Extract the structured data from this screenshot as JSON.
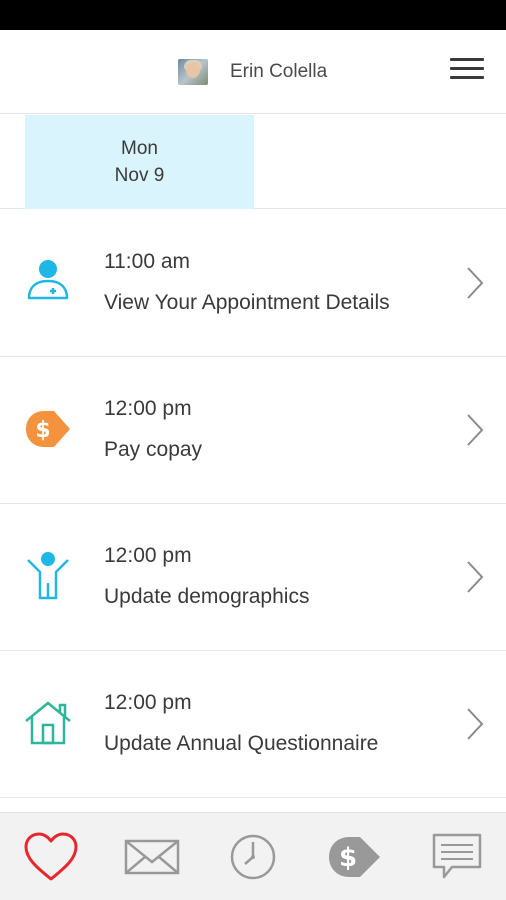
{
  "header": {
    "user_name": "Erin Colella",
    "avatar": "user-photo",
    "menu_icon": "hamburger-menu-icon"
  },
  "date_tabs": [
    {
      "day": "Mon",
      "date": "Nov 9",
      "selected": true
    }
  ],
  "appointments": [
    {
      "time": "11:00 am",
      "title": "View Your Appointment Details",
      "icon": "doctor-icon",
      "color": "#1fb8e6"
    },
    {
      "time": "12:00 pm",
      "title": "Pay copay",
      "icon": "dollar-tag-icon",
      "color": "#f5923e"
    },
    {
      "time": "12:00 pm",
      "title": "Update demographics",
      "icon": "person-arms-up-icon",
      "color": "#1fb8e6"
    },
    {
      "time": "12:00 pm",
      "title": "Update Annual Questionnaire",
      "icon": "house-icon",
      "color": "#2fb59a"
    }
  ],
  "tab_bar": [
    {
      "icon": "heart-icon",
      "color": "#e8262e",
      "active": true
    },
    {
      "icon": "envelope-icon",
      "color": "#999999",
      "active": false
    },
    {
      "icon": "clock-icon",
      "color": "#999999",
      "active": false
    },
    {
      "icon": "dollar-tag-icon",
      "color": "#999999",
      "active": false
    },
    {
      "icon": "chat-bubble-icon",
      "color": "#999999",
      "active": false
    }
  ],
  "colors": {
    "accent_selected_date": "#d9f4fd",
    "divider": "#e6e6e6",
    "text": "#3a3a3a"
  }
}
